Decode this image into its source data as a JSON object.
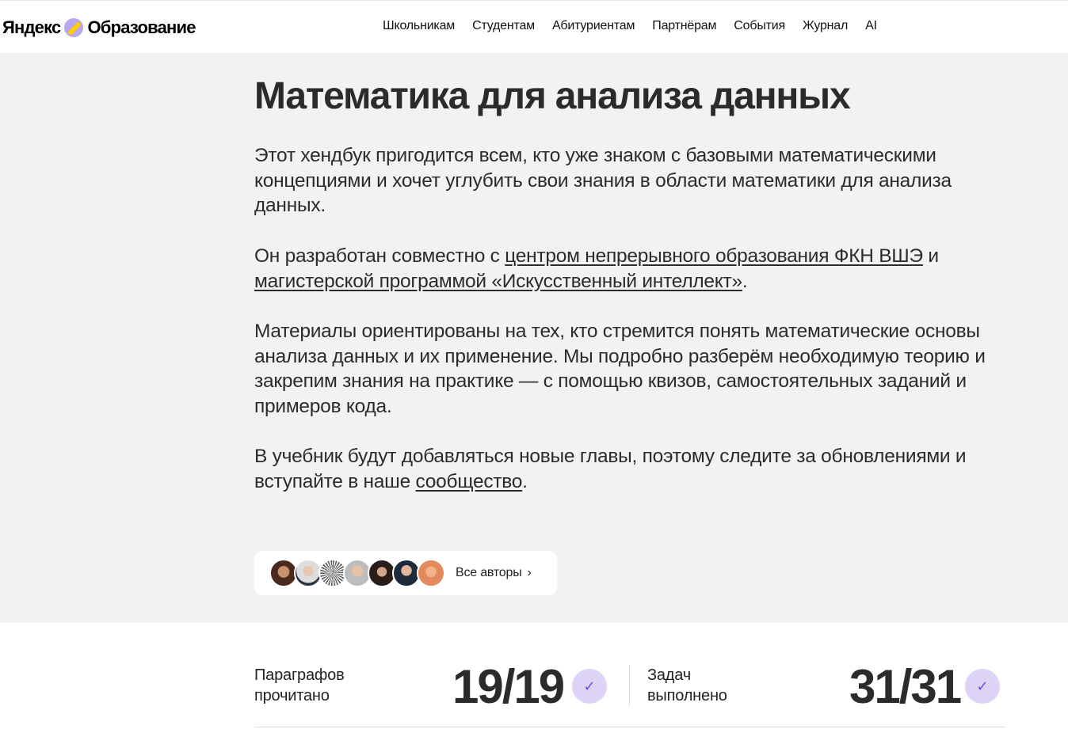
{
  "header": {
    "logo_yandex": "Яндекс",
    "logo_education": "Образование",
    "nav": [
      "Школьникам",
      "Студентам",
      "Абитуриентам",
      "Партнёрам",
      "События",
      "Журнал",
      "AI"
    ]
  },
  "hero": {
    "title": "Математика для анализа данных",
    "p1": "Этот хендбук пригодится всем, кто уже знаком с базовыми математическими концепциями и хочет углубить свои знания в области математики для анализа данных.",
    "p2_pre": "Он разработан совместно с ",
    "p2_link1": "центром непрерывного образования ФКН ВШЭ",
    "p2_mid": " и ",
    "p2_link2": "магистерской программой «Искусственный интеллект»",
    "p2_post": ".",
    "p3": "Материалы ориентированы на тех, кто стремится понять математические основы анализа данных и их применение. Мы подробно разберём необходимую теорию и закрепим знания на практике — с помощью квизов, самостоятельных заданий и примеров кода.",
    "p4_pre": "В учебник будут добавляться новые главы, поэтому следите за обновлениями и вступайте в наше ",
    "p4_link": "сообщество",
    "p4_post": ".",
    "authors_label": "Все авторы",
    "authors_chevron": "›"
  },
  "stats": {
    "paragraphs_label_line1": "Параграфов",
    "paragraphs_label_line2": "прочитано",
    "paragraphs_value": "19/19",
    "tasks_label_line1": "Задач",
    "tasks_label_line2": "выполнено",
    "tasks_value": "31/31",
    "check_glyph": "✓"
  },
  "colors": {
    "hero_bg": "#f2f2f2",
    "check_bg": "#ddd3f7",
    "check_fg": "#6a4fd6",
    "logo_mark": "#b7a6f0",
    "logo_accent": "#ffcc00"
  }
}
